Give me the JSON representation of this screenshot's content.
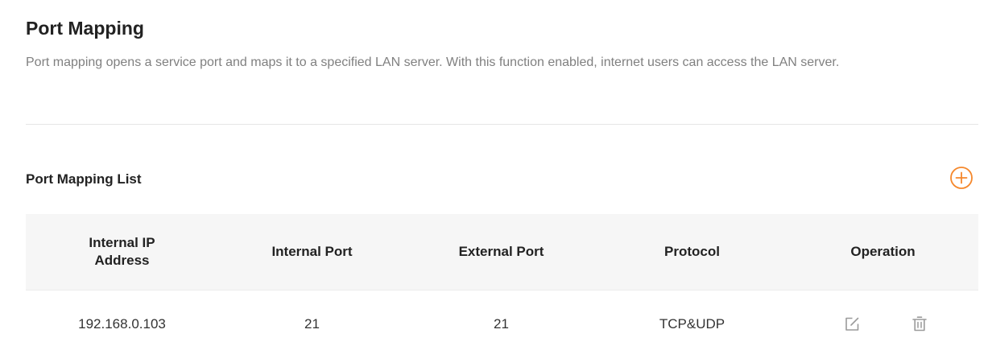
{
  "header": {
    "title": "Port Mapping",
    "description": "Port mapping opens a service port and maps it to a specified LAN server. With this function enabled, internet users can access the LAN server."
  },
  "list": {
    "title": "Port Mapping List",
    "add_icon": "plus-circle-icon",
    "columns": [
      "Internal IP Address",
      "Internal Port",
      "External Port",
      "Protocol",
      "Operation"
    ],
    "rows": [
      {
        "internal_ip": "192.168.0.103",
        "internal_port": "21",
        "external_port": "21",
        "protocol": "TCP&UDP",
        "edit_icon": "edit-icon",
        "delete_icon": "trash-icon"
      }
    ]
  },
  "colors": {
    "accent": "#f5882c",
    "icon_gray": "#9a9a9a",
    "header_bg": "#f6f6f6"
  }
}
